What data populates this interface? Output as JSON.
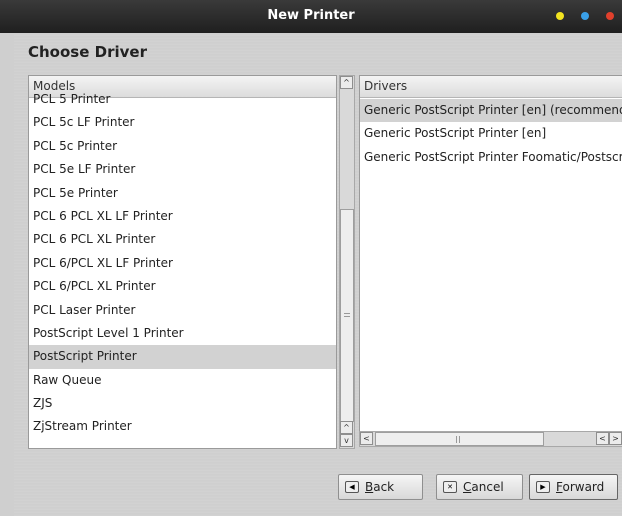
{
  "window": {
    "title": "New Printer"
  },
  "dialog": {
    "heading": "Choose Driver"
  },
  "models": {
    "header": "Models",
    "items": [
      "PCL 5 Printer",
      "PCL 5c LF Printer",
      "PCL 5c Printer",
      "PCL 5e LF Printer",
      "PCL 5e Printer",
      "PCL 6 PCL XL LF Printer",
      "PCL 6 PCL XL Printer",
      "PCL 6/PCL XL LF Printer",
      "PCL 6/PCL XL Printer",
      "PCL Laser Printer",
      "PostScript Level 1 Printer",
      "PostScript Printer",
      "Raw Queue",
      "ZJS",
      "ZjStream Printer"
    ],
    "selected": "PostScript Printer"
  },
  "drivers": {
    "header": "Drivers",
    "items": [
      "Generic PostScript Printer [en] (recommended)",
      "Generic PostScript Printer [en]",
      "Generic PostScript Printer Foomatic/Postscript [en]"
    ],
    "selected": "Generic PostScript Printer [en] (recommended)"
  },
  "buttons": {
    "back_pre": "",
    "back_key": "B",
    "back_post": "ack",
    "cancel_pre": "",
    "cancel_key": "C",
    "cancel_post": "ancel",
    "forward_pre": "",
    "forward_key": "F",
    "forward_post": "orward"
  },
  "icons": {
    "back": "back-arrow-icon",
    "cancel": "cancel-x-icon",
    "forward": "forward-arrow-icon"
  },
  "colors": {
    "dot_yellow": "#f2e320",
    "dot_blue": "#3aa0e8",
    "dot_red": "#e0402c"
  }
}
